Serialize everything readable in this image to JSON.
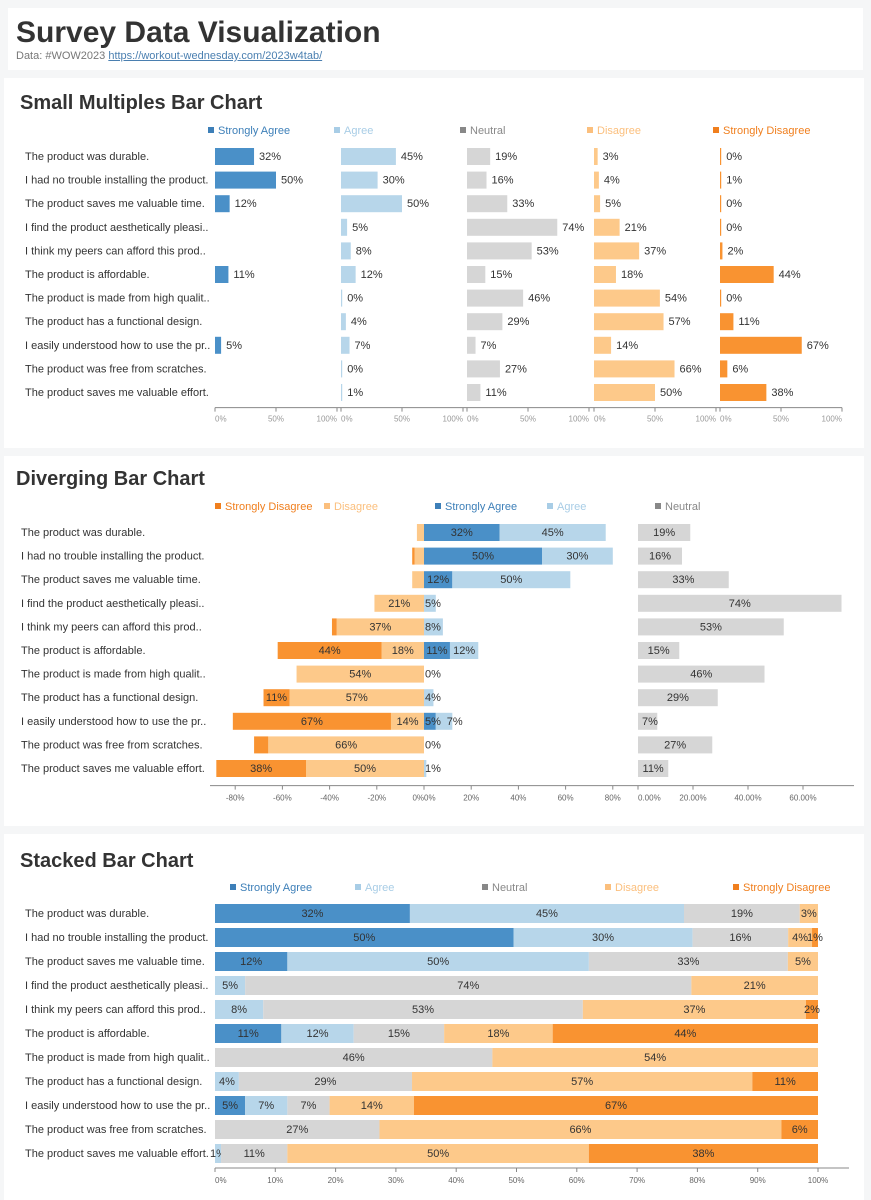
{
  "header": {
    "title": "Survey Data Visualization",
    "data_prefix": "Data: #WOW2023",
    "data_link": "https://workout-wednesday.com/2023w4tab/"
  },
  "colors": {
    "strongly_agree": "#4a90c8",
    "agree": "#b7d6ea",
    "neutral": "#d6d6d6",
    "disagree": "#fdc98a",
    "strongly_disagree": "#f99331"
  },
  "legend": {
    "strongly_agree": "Strongly Agree",
    "agree": "Agree",
    "neutral": "Neutral",
    "disagree": "Disagree",
    "strongly_disagree": "Strongly Disagree"
  },
  "chart_data": [
    {
      "type": "bar",
      "title": "Small Multiples Bar Chart",
      "categories": [
        "The product was durable.",
        "I had no trouble installing the product.",
        "The product saves me valuable time.",
        "I find the product aesthetically pleasi..",
        "I think my peers can afford this prod..",
        "The product is affordable.",
        "The product is made from high qualit..",
        "The product has a functional design.",
        "I easily understood how to use the pr..",
        "The product was free from scratches.",
        "The product saves me valuable effort."
      ],
      "series": [
        {
          "name": "Strongly Agree",
          "values": [
            32,
            50,
            12,
            0,
            0,
            11,
            0,
            0,
            5,
            0,
            0
          ],
          "labels": [
            true,
            true,
            true,
            false,
            false,
            true,
            false,
            false,
            true,
            false,
            false
          ]
        },
        {
          "name": "Agree",
          "values": [
            45,
            30,
            50,
            5,
            8,
            12,
            0,
            4,
            7,
            0,
            1
          ]
        },
        {
          "name": "Neutral",
          "values": [
            19,
            16,
            33,
            74,
            53,
            15,
            46,
            29,
            7,
            27,
            11
          ]
        },
        {
          "name": "Disagree",
          "values": [
            3,
            4,
            5,
            21,
            37,
            18,
            54,
            57,
            14,
            66,
            50
          ]
        },
        {
          "name": "Strongly Disagree",
          "values": [
            0,
            1,
            0,
            0,
            2,
            44,
            0,
            11,
            67,
            6,
            38
          ]
        }
      ],
      "xticks": [
        "0%",
        "50%",
        "100%"
      ],
      "xlim": [
        0,
        100
      ]
    },
    {
      "type": "bar",
      "title": "Diverging Bar Chart",
      "categories": [
        "The product was durable.",
        "I had no trouble installing the product.",
        "The product saves me valuable time.",
        "I find the product aesthetically pleasi..",
        "I think my peers can afford this prod..",
        "The product is affordable.",
        "The product is made from high qualit..",
        "The product has a functional design.",
        "I easily understood how to use the pr..",
        "The product was free from scratches.",
        "The product saves me valuable effort."
      ],
      "left_ticks": [
        "-80%",
        "-60%",
        "-40%",
        "-20%",
        "0%"
      ],
      "right_ticks": [
        "0%",
        "20%",
        "40%",
        "60%",
        "80%"
      ],
      "neutral_ticks": [
        "0.00%",
        "20.00%",
        "40.00%",
        "60.00%"
      ],
      "xlim_left": [
        -88,
        0
      ],
      "xlim_right": [
        0,
        88
      ],
      "xlim_neutral": [
        0,
        78
      ]
    },
    {
      "type": "bar",
      "title": "Stacked Bar Chart",
      "categories": [
        "The product was durable.",
        "I had no trouble installing the product.",
        "The product saves me valuable time.",
        "I find the product aesthetically pleasi..",
        "I think my peers can afford this prod..",
        "The product is affordable.",
        "The product is made from high qualit..",
        "The product has a functional design.",
        "I easily understood how to use the pr..",
        "The product was free from scratches.",
        "The product saves me valuable effort."
      ],
      "xticks": [
        "0%",
        "10%",
        "20%",
        "30%",
        "40%",
        "50%",
        "60%",
        "70%",
        "80%",
        "90%",
        "100%"
      ],
      "xlim": [
        0,
        100
      ]
    }
  ]
}
